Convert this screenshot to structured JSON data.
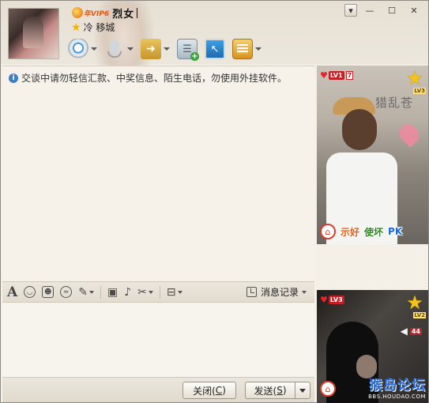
{
  "header": {
    "vip_label": "年VIP6",
    "nickname": "烈女",
    "signature": "冷 移城"
  },
  "toolbar": {
    "items": [
      "video-call",
      "voice-call",
      "send-file",
      "apps",
      "remote-assist",
      "app-box"
    ]
  },
  "window_controls": {
    "minimize": "—",
    "maximize": "☐",
    "close": "✕"
  },
  "notice": "交谈中请勿轻信汇款、中奖信息、陌生电话，勿使用外挂软件。",
  "input_toolbar": {
    "history_label": "消息记录"
  },
  "buttons": {
    "close_label": "关闭(",
    "close_key": "C",
    "close_suffix": ")",
    "send_label": "发送(",
    "send_key": "S",
    "send_suffix": ")"
  },
  "video_top": {
    "level": "LV1",
    "level_extra": "7",
    "star_level": "LV3",
    "wall_text": "猎乱苍",
    "action_1": "示好",
    "action_2": "使坏",
    "action_3": "PK"
  },
  "video_bottom": {
    "level": "LV3",
    "star_level": "LV2",
    "volume": "44",
    "watermark": "猴岛论坛",
    "watermark_url": "BBS.HOUDAO.COM"
  },
  "colors": {
    "accent": "#e05a14",
    "level_red": "#c41f24",
    "star_gold": "#f3c21b",
    "watermark_blue": "#2a6bd6"
  }
}
